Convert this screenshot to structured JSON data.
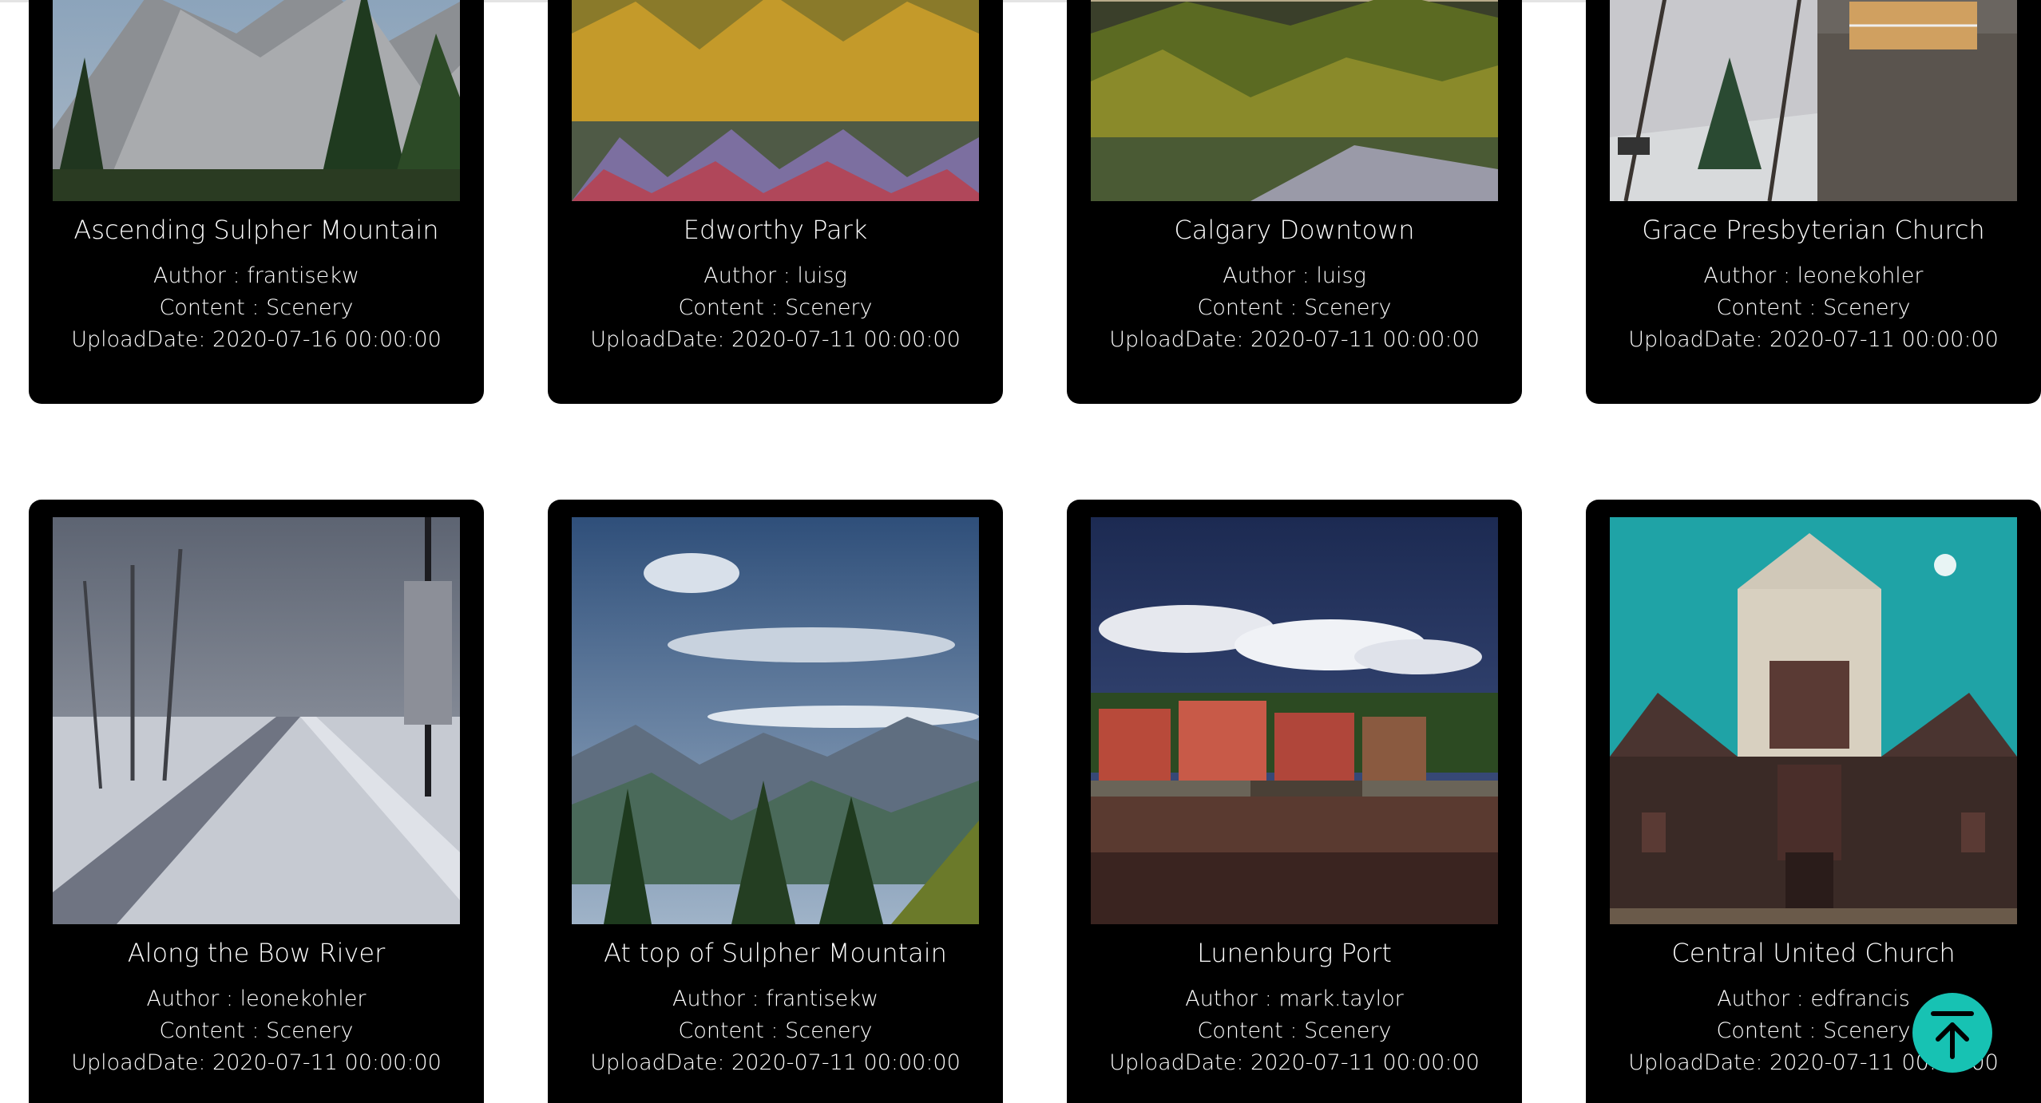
{
  "gallery": {
    "cards": [
      {
        "title": "Ascending Sulpher Mountain",
        "author": "Author : frantisekw",
        "content": "Content : Scenery",
        "upload": "UploadDate: 2020-07-16 00:00:00"
      },
      {
        "title": "Edworthy Park",
        "author": "Author : luisg",
        "content": "Content : Scenery",
        "upload": "UploadDate: 2020-07-11 00:00:00"
      },
      {
        "title": "Calgary Downtown",
        "author": "Author : luisg",
        "content": "Content : Scenery",
        "upload": "UploadDate: 2020-07-11 00:00:00"
      },
      {
        "title": "Grace Presbyterian Church",
        "author": "Author : leonekohler",
        "content": "Content : Scenery",
        "upload": "UploadDate: 2020-07-11 00:00:00"
      },
      {
        "title": "Along the Bow River",
        "author": "Author : leonekohler",
        "content": "Content : Scenery",
        "upload": "UploadDate: 2020-07-11 00:00:00"
      },
      {
        "title": "At top of Sulpher Mountain",
        "author": "Author : frantisekw",
        "content": "Content : Scenery",
        "upload": "UploadDate: 2020-07-11 00:00:00"
      },
      {
        "title": "Lunenburg Port",
        "author": "Author : mark.taylor",
        "content": "Content : Scenery",
        "upload": "UploadDate: 2020-07-11 00:00:00"
      },
      {
        "title": "Central United Church",
        "author": "Author : edfrancis",
        "content": "Content : Scenery",
        "upload": "UploadDate: 2020-07-11 00:00:00"
      }
    ]
  },
  "back_to_top": {
    "icon": "arrow-up-to-top-icon",
    "color": "#17c2b3"
  }
}
